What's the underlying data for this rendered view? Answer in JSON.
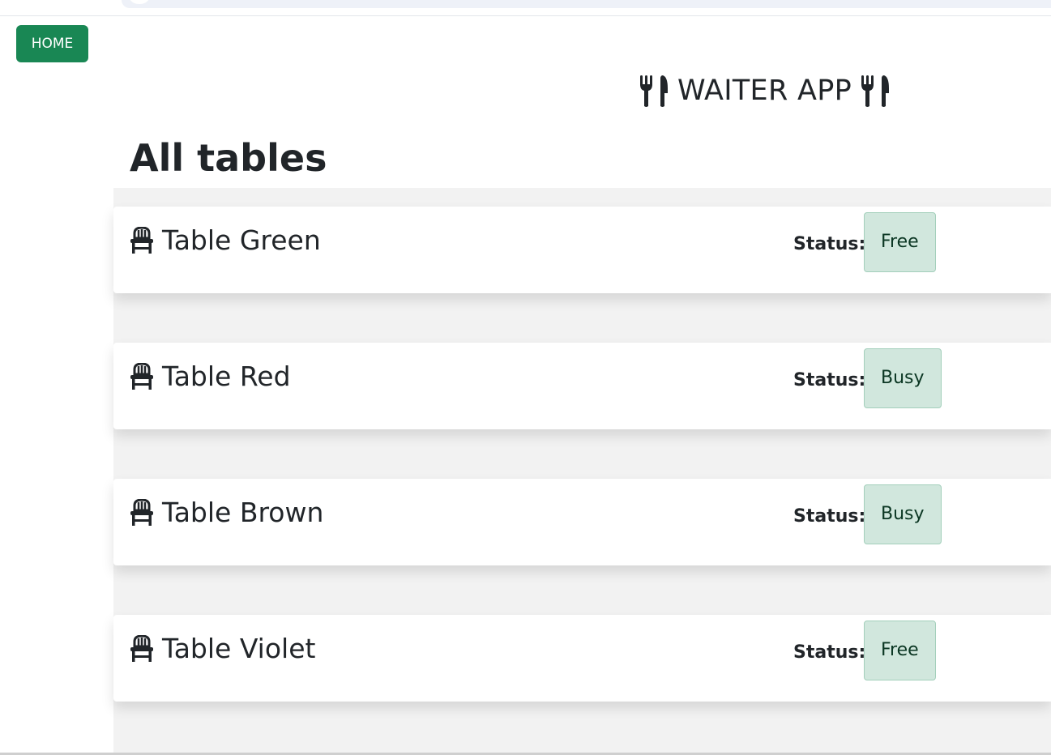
{
  "nav": {
    "home_label": "HOME"
  },
  "header": {
    "app_title": "WAITER APP",
    "icon": "utensils-icon"
  },
  "page": {
    "title": "All tables"
  },
  "tables": [
    {
      "name": "Table Green",
      "status_label": "Status:",
      "status": "Free"
    },
    {
      "name": "Table Red",
      "status_label": "Status:",
      "status": "Busy"
    },
    {
      "name": "Table Brown",
      "status_label": "Status:",
      "status": "Busy"
    },
    {
      "name": "Table Violet",
      "status_label": "Status:",
      "status": "Free"
    }
  ],
  "colors": {
    "brand_green": "#198754",
    "badge_bg": "#d1e7dd",
    "badge_text": "#0a3622"
  }
}
